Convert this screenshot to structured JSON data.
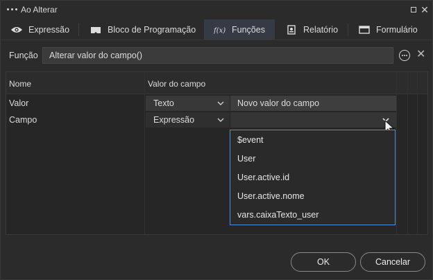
{
  "window": {
    "title": "Ao Alterar"
  },
  "tabs": [
    {
      "label": "Expressão",
      "icon": "eye-icon",
      "active": false
    },
    {
      "label": "Bloco de Programação",
      "icon": "block-icon",
      "active": false
    },
    {
      "label": "Funções",
      "icon": "function-icon",
      "active": true
    },
    {
      "label": "Relatório",
      "icon": "report-icon",
      "active": false
    },
    {
      "label": "Formulário",
      "icon": "form-window-icon",
      "active": false
    }
  ],
  "function_row": {
    "label": "Função",
    "value": "Alterar valor do campo()"
  },
  "grid": {
    "headers": {
      "name": "Nome",
      "value": "Valor do campo"
    },
    "rows": [
      {
        "name": "Valor",
        "type": "Texto",
        "value": "Novo valor do campo"
      },
      {
        "name": "Campo",
        "type": "Expressão",
        "value": ""
      }
    ]
  },
  "dropdown": {
    "options": [
      "$event",
      "User",
      "User.active.id",
      "User.active.nome",
      "vars.caixaTexto_user"
    ]
  },
  "buttons": {
    "ok": "OK",
    "cancel": "Cancelar"
  },
  "colors": {
    "accent": "#4a90d9",
    "active_tab": "#353a45",
    "background": "#2b2b2b"
  }
}
